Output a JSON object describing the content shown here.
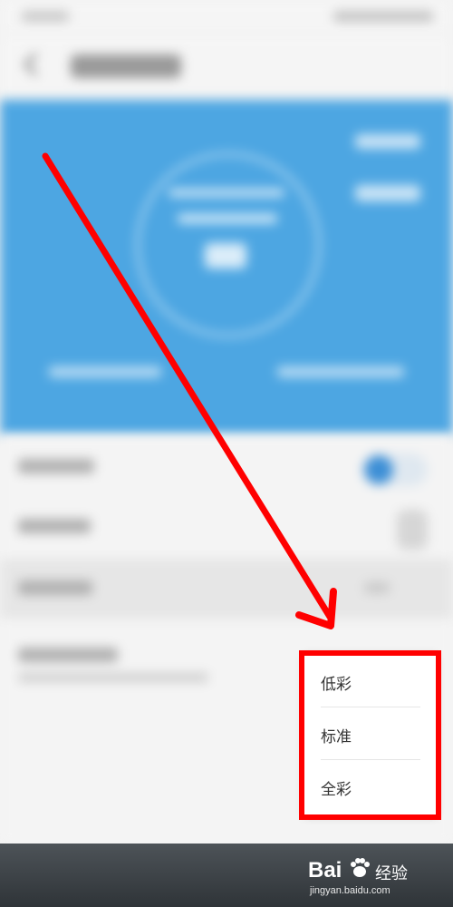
{
  "popup_menu": {
    "items": [
      {
        "label": "低彩"
      },
      {
        "label": "标准"
      },
      {
        "label": "全彩"
      }
    ]
  },
  "annotation": {
    "arrow_color": "#ff0000",
    "box_color": "#ff0000"
  },
  "watermark": {
    "logo_left": "Bai",
    "logo_right": "经验",
    "url": "jingyan.baidu.com"
  },
  "colors": {
    "hero_blue": "#4da6e2",
    "toggle_blue": "#3d8fd6",
    "bottom_band": "#3a3f43"
  },
  "icons": [
    "back-chevron-icon",
    "toggle-switch",
    "baidu-paw-icon"
  ]
}
